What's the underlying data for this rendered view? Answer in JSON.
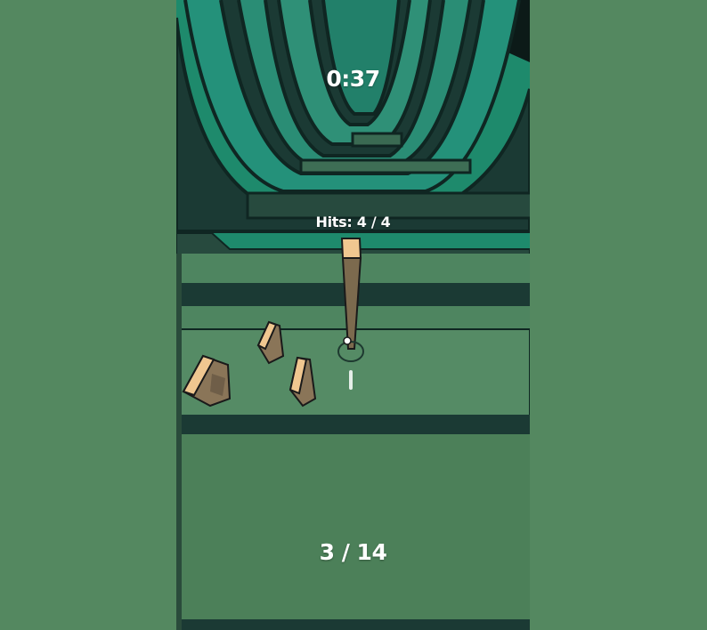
{
  "hud": {
    "timer": "0:37",
    "hits_label": "Hits: 4 / 4",
    "level_progress": "3 / 14"
  },
  "scene": {
    "blocks_visible": 3,
    "icons": [
      "aim-reticle-icon",
      "bat-stick-icon",
      "block-icon"
    ]
  },
  "colors": {
    "page_background": "#548860",
    "tunnel_wall": "#1e8a6c",
    "tunnel_dark": "#1b3a34",
    "floor": "#4c8059",
    "block_top": "#f0c790",
    "block_side": "#8a7558",
    "hud_text": "#ffffff"
  }
}
